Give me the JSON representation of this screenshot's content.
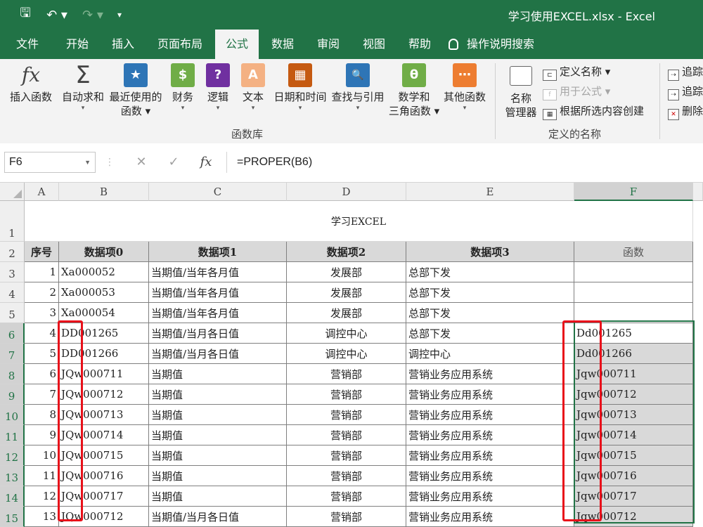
{
  "window": {
    "title": "学习使用EXCEL.xlsx  -  Excel"
  },
  "quick_access": {
    "save": "🖫",
    "undo": "↶ ▾",
    "redo": "↷ ▾",
    "customize": "▾"
  },
  "tabs": [
    "文件",
    "开始",
    "插入",
    "页面布局",
    "公式",
    "数据",
    "审阅",
    "视图",
    "帮助"
  ],
  "active_tab": "公式",
  "tell_me": "操作说明搜索",
  "ribbon": {
    "function_library": {
      "label": "函数库",
      "buttons": [
        {
          "line1": "插入函数",
          "line2": "",
          "icon": "fx"
        },
        {
          "line1": "自动求和",
          "line2": "▾",
          "icon": "Σ"
        },
        {
          "line1": "最近使用的",
          "line2": "函数 ▾",
          "icon": "★"
        },
        {
          "line1": "财务",
          "line2": "▾",
          "icon": "$"
        },
        {
          "line1": "逻辑",
          "line2": "▾",
          "icon": "?"
        },
        {
          "line1": "文本",
          "line2": "▾",
          "icon": "A"
        },
        {
          "line1": "日期和时间",
          "line2": "▾",
          "icon": "▦"
        },
        {
          "line1": "查找与引用",
          "line2": "▾",
          "icon": "🔍"
        },
        {
          "line1": "数学和",
          "line2": "三角函数 ▾",
          "icon": "θ"
        },
        {
          "line1": "其他函数",
          "line2": "▾",
          "icon": "⋯"
        }
      ]
    },
    "defined_names": {
      "label": "定义的名称",
      "name_manager": {
        "line1": "名称",
        "line2": "管理器"
      },
      "define_name": "定义名称 ▾",
      "use_in_formula": "用于公式 ▾",
      "create_from_selection": "根据所选内容创建"
    },
    "auditing": {
      "trace1": "追踪",
      "trace2": "追踪",
      "remove": "删除"
    }
  },
  "formula_bar": {
    "name_box": "F6",
    "formula": "=PROPER(B6)",
    "cancel": "✕",
    "enter": "✓",
    "fx": "fx"
  },
  "sheet": {
    "columns": [
      "A",
      "B",
      "C",
      "D",
      "E",
      "F"
    ],
    "rows": [
      "1",
      "2",
      "3",
      "4",
      "5",
      "6",
      "7",
      "8",
      "9",
      "10",
      "11",
      "12",
      "13",
      "14",
      "15"
    ],
    "title": "学习EXCEL",
    "headers": [
      "序号",
      "数据项0",
      "数据项1",
      "数据项2",
      "数据项3",
      "函数"
    ],
    "data": [
      [
        "1",
        "Xa000052",
        "当期值/当年各月值",
        "发展部",
        "总部下发",
        ""
      ],
      [
        "2",
        "Xa000053",
        "当期值/当年各月值",
        "发展部",
        "总部下发",
        ""
      ],
      [
        "3",
        "Xa000054",
        "当期值/当年各月值",
        "发展部",
        "总部下发",
        ""
      ],
      [
        "4",
        "DD001265",
        "当期值/当月各日值",
        "调控中心",
        "总部下发",
        "Dd001265"
      ],
      [
        "5",
        "DD001266",
        "当期值/当月各日值",
        "调控中心",
        "调控中心",
        "Dd001266"
      ],
      [
        "6",
        "JQw000711",
        "当期值",
        "营销部",
        "营销业务应用系统",
        "Jqw000711"
      ],
      [
        "7",
        "JQw000712",
        "当期值",
        "营销部",
        "营销业务应用系统",
        "Jqw000712"
      ],
      [
        "8",
        "JQw000713",
        "当期值",
        "营销部",
        "营销业务应用系统",
        "Jqw000713"
      ],
      [
        "9",
        "JQw000714",
        "当期值",
        "营销部",
        "营销业务应用系统",
        "Jqw000714"
      ],
      [
        "10",
        "JQw000715",
        "当期值",
        "营销部",
        "营销业务应用系统",
        "Jqw000715"
      ],
      [
        "11",
        "JQw000716",
        "当期值",
        "营销部",
        "营销业务应用系统",
        "Jqw000716"
      ],
      [
        "12",
        "JQw000717",
        "当期值",
        "营销部",
        "营销业务应用系统",
        "Jqw000717"
      ],
      [
        "13",
        "JQw000712",
        "当期值/当月各日值",
        "营销部",
        "营销业务应用系统",
        "Jqw000712"
      ]
    ]
  },
  "colors": {
    "excel_green": "#217346",
    "highlight_red": "#e8101a",
    "header_gray": "#d9d9d9"
  }
}
